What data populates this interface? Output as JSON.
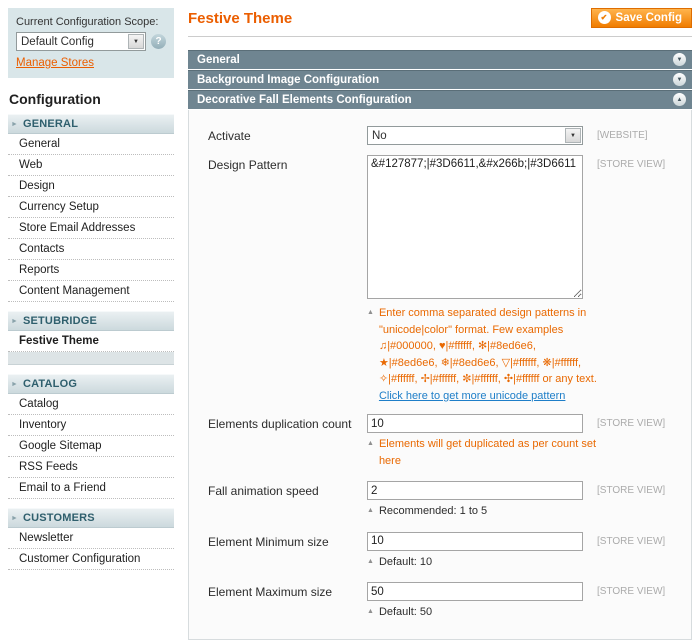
{
  "scope_panel": {
    "label": "Current Configuration Scope:",
    "select_value": "Default Config",
    "select_arrow_glyph": "▼",
    "help_glyph": "?",
    "manage_stores_link": "Manage Stores"
  },
  "sidebar": {
    "title": "Configuration",
    "section_arrow_glyph": "►",
    "active_item": "Festive Theme",
    "sections": [
      {
        "label": "GENERAL",
        "items": [
          "General",
          "Web",
          "Design",
          "Currency Setup",
          "Store Email Addresses",
          "Contacts",
          "Reports",
          "Content Management"
        ]
      },
      {
        "label": "SETUBRIDGE",
        "items": [
          "Festive Theme"
        ]
      },
      {
        "label": "CATALOG",
        "items": [
          "Catalog",
          "Inventory",
          "Google Sitemap",
          "RSS Feeds",
          "Email to a Friend"
        ]
      },
      {
        "label": "CUSTOMERS",
        "items": [
          "Newsletter",
          "Customer Configuration"
        ]
      }
    ]
  },
  "main": {
    "page_title": "Festive Theme",
    "save_button_label": "Save Config",
    "save_icon_glyph": "✔",
    "accordion": [
      {
        "label": "General",
        "state": "collapsed",
        "icon_glyph": "▼"
      },
      {
        "label": "Background Image Configuration",
        "state": "collapsed",
        "icon_glyph": "▼"
      },
      {
        "label": "Decorative Fall Elements Configuration",
        "state": "expanded",
        "icon_glyph": "▲"
      }
    ],
    "form": {
      "note_marker_glyph": "▲",
      "fields": [
        {
          "label": "Activate",
          "type": "select",
          "value": "No",
          "scope": "[WEBSITE]"
        },
        {
          "label": "Design Pattern",
          "type": "textarea",
          "value": "&#127877;|#3D6611,&#x266b;|#3D6611",
          "scope": "[STORE VIEW]",
          "note": "Enter comma separated design patterns in \"unicode|color\" format. Few examples ♫|#000000, ♥|#ffffff, ✻|#8ed6e6, ★|#8ed6e6, ❄|#8ed6e6, ▽|#ffffff, ❋|#ffffff, ✧|#ffffff, ✢|#ffffff, ✼|#ffffff, ✣|#ffffff or any text. ",
          "note_link": "Click here to get more unicode pattern"
        },
        {
          "label": "Elements duplication count",
          "type": "input",
          "value": "10",
          "scope": "[STORE VIEW]",
          "note": "Elements will get duplicated as per count set here"
        },
        {
          "label": "Fall animation speed",
          "type": "input",
          "value": "2",
          "scope": "[STORE VIEW]",
          "note": "Recommended: 1 to 5"
        },
        {
          "label": "Element Minimum size",
          "type": "input",
          "value": "10",
          "scope": "[STORE VIEW]",
          "note": "Default: 10"
        },
        {
          "label": "Element Maximum size",
          "type": "input",
          "value": "50",
          "scope": "[STORE VIEW]",
          "note": "Default: 50"
        }
      ]
    }
  },
  "colors": {
    "accent_orange": "#eb5e00",
    "note_orange": "#e96902",
    "accordion_header_bg": "#6f8591",
    "scope_box_bg": "#d9e6e9",
    "link_blue": "#1e7ec8"
  }
}
